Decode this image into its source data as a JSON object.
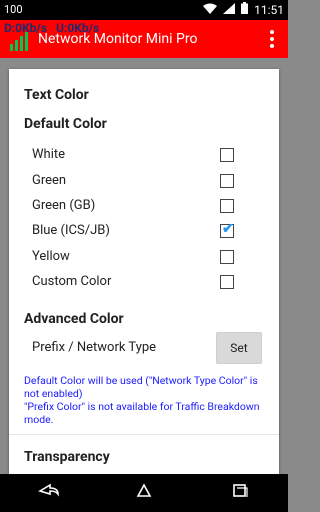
{
  "statusbar": {
    "left_text": "100",
    "time": "11:51"
  },
  "appbar": {
    "speed_down": "D:0Kb/s",
    "speed_up": "U:0Kb/s",
    "title": "Network Monitor Mini Pro"
  },
  "dialog": {
    "text_color_title": "Text Color",
    "default_color_title": "Default Color",
    "options": [
      {
        "label": "White",
        "checked": false
      },
      {
        "label": "Green",
        "checked": false
      },
      {
        "label": "Green (GB)",
        "checked": false
      },
      {
        "label": "Blue (ICS/JB)",
        "checked": true
      },
      {
        "label": "Yellow",
        "checked": false
      },
      {
        "label": "Custom Color",
        "checked": false
      }
    ],
    "advanced_color_title": "Advanced Color",
    "advanced_item_label": "Prefix / Network Type",
    "set_button_label": "Set",
    "note": "Default Color will be used (\"Network Type Color\" is not enabled)\n\"Prefix Color\" is not available for Traffic Breakdown mode.",
    "transparency_title": "Transparency"
  },
  "colors": {
    "appbar": "#ff0000",
    "note_text": "#1a1aff",
    "check_accent": "#2196f3"
  }
}
